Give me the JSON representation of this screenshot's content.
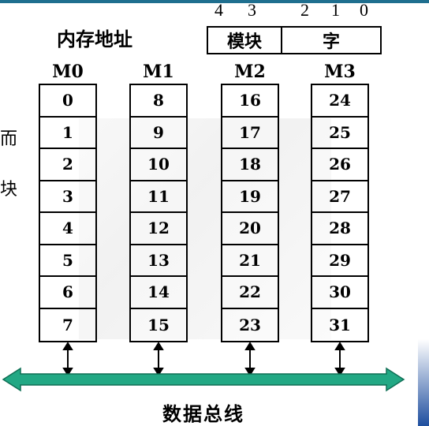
{
  "address_format": {
    "title": "内存地址",
    "bits": [
      "4",
      "3",
      "2",
      "1",
      "0"
    ],
    "module_field": "模块",
    "word_field": "字"
  },
  "left_edge_chars": [
    "而",
    "块"
  ],
  "modules": [
    {
      "name": "M0",
      "cells": [
        "0",
        "1",
        "2",
        "3",
        "4",
        "5",
        "6",
        "7"
      ]
    },
    {
      "name": "M1",
      "cells": [
        "8",
        "9",
        "10",
        "11",
        "12",
        "13",
        "14",
        "15"
      ]
    },
    {
      "name": "M2",
      "cells": [
        "16",
        "17",
        "18",
        "19",
        "20",
        "21",
        "22",
        "23"
      ]
    },
    {
      "name": "M3",
      "cells": [
        "24",
        "25",
        "26",
        "27",
        "28",
        "29",
        "30",
        "31"
      ]
    }
  ],
  "bus": {
    "label": "数据总线",
    "color": "#22a884"
  },
  "colors": {
    "top_rule": "#1f6f8f"
  }
}
